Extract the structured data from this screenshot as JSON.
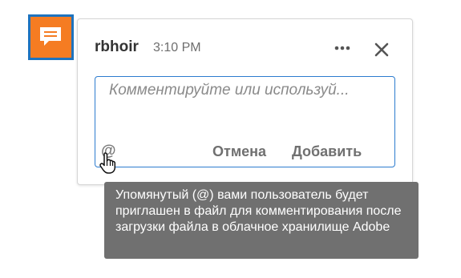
{
  "comment": {
    "author": "rbhoir",
    "time": "3:10 PM",
    "placeholder": "Комментируйте или используй...",
    "mention_symbol": "@",
    "cancel_label": "Отмена",
    "add_label": "Добавить"
  },
  "tooltip": {
    "text": "Упомянутый (@) вами пользователь будет приглашен в файл для комментирования после загрузки файла в облачное хранилище Adobe"
  },
  "icons": {
    "comment": "comment-icon",
    "more": "more-icon",
    "close": "close-icon",
    "cursor": "hand-cursor-icon"
  },
  "colors": {
    "accent_orange": "#f57c22",
    "accent_blue": "#2d7ccf",
    "tooltip_bg": "#707070"
  }
}
